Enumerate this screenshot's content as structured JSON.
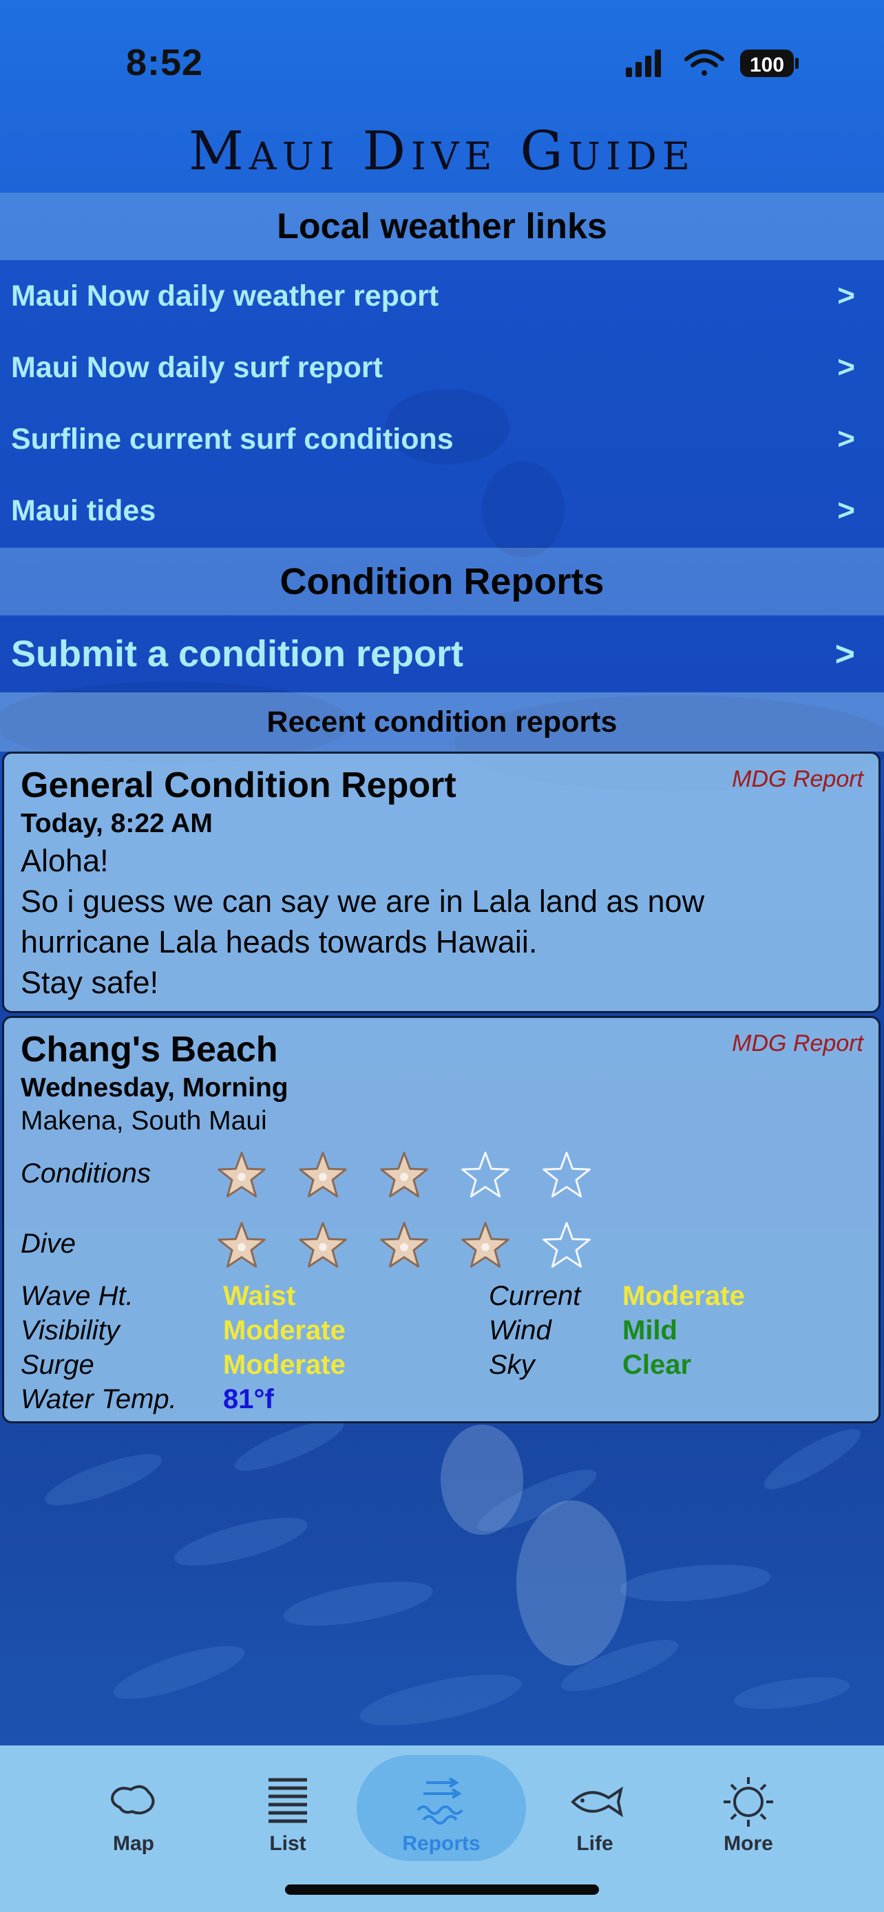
{
  "status_bar": {
    "time": "8:52",
    "battery": "100"
  },
  "app": {
    "title": "Maui Dive Guide"
  },
  "weather": {
    "heading": "Local weather links",
    "links": [
      {
        "label": "Maui Now daily weather report",
        "chevron": ">"
      },
      {
        "label": "Maui Now daily surf report",
        "chevron": ">"
      },
      {
        "label": "Surfline current surf conditions",
        "chevron": ">"
      },
      {
        "label": "Maui tides",
        "chevron": ">"
      }
    ]
  },
  "conditions": {
    "heading": "Condition Reports",
    "submit": {
      "label": "Submit a condition report",
      "chevron": ">"
    },
    "recent_heading": "Recent condition reports"
  },
  "reports": [
    {
      "badge": "MDG Report",
      "title": "General Condition Report",
      "when": "Today, 8:22 AM",
      "body": [
        "Aloha!",
        "So i guess we can say we are in Lala land as now",
        "hurricane Lala heads towards Hawaii.",
        "Stay safe!"
      ]
    },
    {
      "badge": "MDG Report",
      "title": "Chang's Beach",
      "when": "Wednesday, Morning",
      "location": "Makena, South Maui",
      "ratings": [
        {
          "label": "Conditions",
          "value": 3,
          "max": 5
        },
        {
          "label": "Dive",
          "value": 4,
          "max": 5
        }
      ],
      "details_left": [
        {
          "label": "Wave Ht.",
          "value": "Waist",
          "color": "#f1e83a"
        },
        {
          "label": "Visibility",
          "value": "Moderate",
          "color": "#f1e83a"
        },
        {
          "label": "Surge",
          "value": "Moderate",
          "color": "#f1e83a"
        },
        {
          "label": "Water Temp.",
          "value": "81°f",
          "color": "#1414d8"
        }
      ],
      "details_right": [
        {
          "label": "Current",
          "value": "Moderate",
          "color": "#f1e83a"
        },
        {
          "label": "Wind",
          "value": "Mild",
          "color": "#1a8a1a"
        },
        {
          "label": "Sky",
          "value": "Clear",
          "color": "#1a8a1a"
        }
      ]
    }
  ],
  "tabbar": {
    "tabs": [
      {
        "label": "Map",
        "icon": "map-icon"
      },
      {
        "label": "List",
        "icon": "list-icon"
      },
      {
        "label": "Reports",
        "icon": "reports-waves-icon",
        "active": true
      },
      {
        "label": "Life",
        "icon": "fish-icon"
      },
      {
        "label": "More",
        "icon": "sun-gear-icon"
      }
    ]
  },
  "colors": {
    "link_text": "#a9ecf5",
    "accent": "#2e86de",
    "badge": "#a21a1a"
  }
}
